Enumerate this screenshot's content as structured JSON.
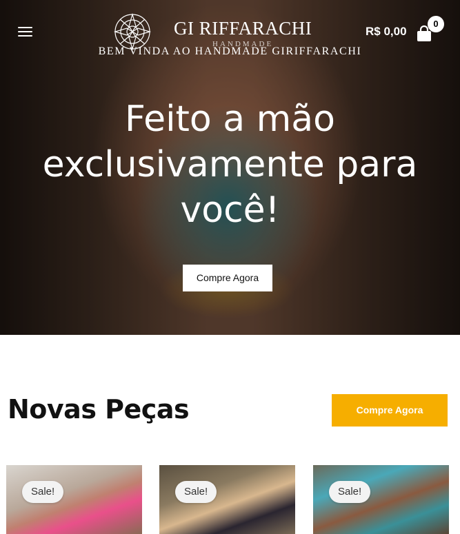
{
  "header": {
    "brand_name": "GI RIFFARACHI",
    "brand_sub": "HANDMADE",
    "welcome": "BEM VINDA AO HANDMADE GIRIFFARACHI",
    "cart_total": "R$ 0,00",
    "cart_count": "0",
    "icons": {
      "menu": "hamburger-icon",
      "cart": "shopping-bag-icon",
      "logo": "mandala-emblem"
    }
  },
  "hero": {
    "headline": "Feito a mão exclusivamente para você!",
    "cta_label": "Compre Agora"
  },
  "section": {
    "title": "Novas Peças",
    "cta_label": "Compre Agora",
    "accent": "#f6ae00"
  },
  "products": [
    {
      "badge": "Sale!"
    },
    {
      "badge": "Sale!"
    },
    {
      "badge": "Sale!"
    }
  ]
}
